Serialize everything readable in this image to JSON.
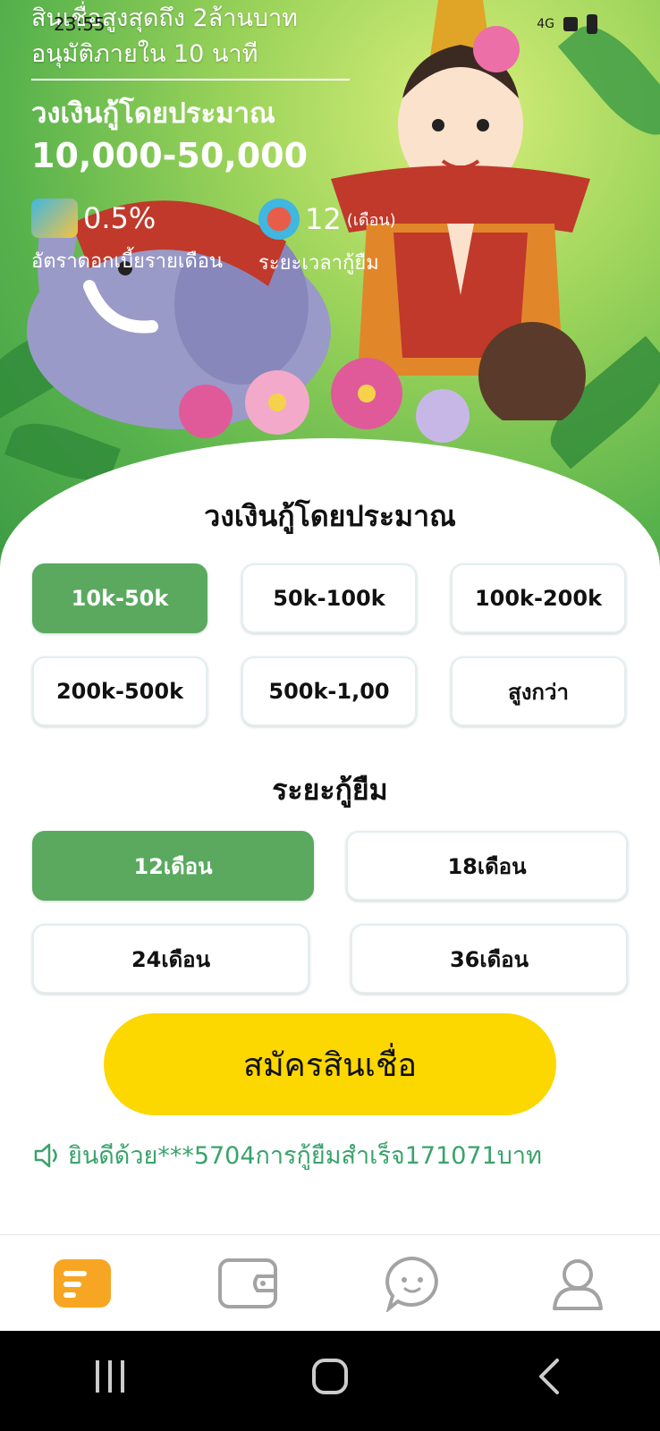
{
  "status_bar": {
    "time": "23:55",
    "network": "4G"
  },
  "hero": {
    "promo_line1": "สินเชื่อสูงสุดถึง 2ล้านบาท",
    "promo_line2": "อนุมัติภายใน 10 นาที",
    "title": "วงเงินกู้โดยประมาณ",
    "range": "10,000-50,000",
    "rate_value": "0.5%",
    "rate_label": "อัตราดอกเบี้ยรายเดือน",
    "term_value": "12",
    "term_unit": "(เดือน)",
    "term_label": "ระยะเวลากู้ยืม"
  },
  "amount_section": {
    "title": "วงเงินกู้โดยประมาณ",
    "options": [
      "10k-50k",
      "50k-100k",
      "100k-200k",
      "200k-500k",
      "500k-1,00",
      "สูงกว่า"
    ],
    "selected": "10k-50k"
  },
  "term_section": {
    "title": "ระยะกู้ยืม",
    "options": [
      "12เดือน",
      "18เดือน",
      "24เดือน",
      "36เดือน"
    ],
    "selected": "12เดือน"
  },
  "apply_button": "สมัครสินเชื่อ",
  "ticker": "ยินดีด้วย***5704การกู้ยืมสำเร็จ171071บาท",
  "tabs": [
    {
      "icon": "home-list-icon",
      "active": true
    },
    {
      "icon": "wallet-icon",
      "active": false
    },
    {
      "icon": "chat-icon",
      "active": false
    },
    {
      "icon": "profile-icon",
      "active": false
    }
  ],
  "colors": {
    "accent_green": "#5aa95f",
    "button_yellow": "#fcd700",
    "ticker_green": "#3aa36b",
    "tab_active": "#f7a623"
  }
}
